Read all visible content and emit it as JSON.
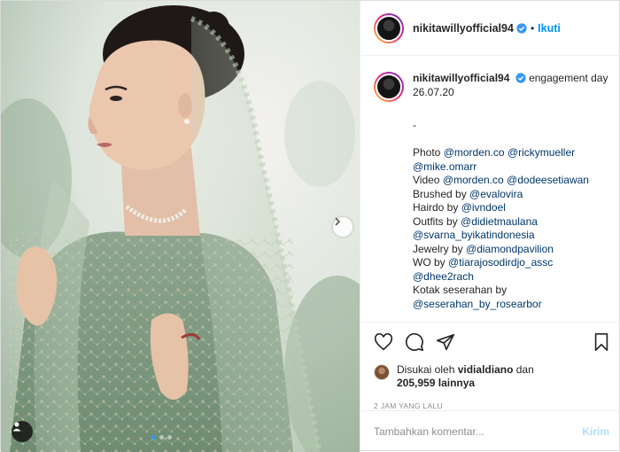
{
  "post": {
    "username": "nikitawillyofficial94",
    "follow_label": "Ikuti",
    "separator": "•",
    "caption_first": "engagement day 26.07.20",
    "caption_lines": [
      {
        "plain": "-",
        "mentions": []
      },
      {
        "plain": "",
        "mentions": []
      },
      {
        "plain": "Photo ",
        "mentions": [
          "@morden.co",
          "@rickymueller"
        ]
      },
      {
        "plain": "",
        "mentions": [
          "@mike.omarr"
        ]
      },
      {
        "plain": "Video ",
        "mentions": [
          "@morden.co",
          "@dodeesetiawan"
        ]
      },
      {
        "plain": "Brushed by ",
        "mentions": [
          "@evalovira"
        ]
      },
      {
        "plain": "Hairdo by ",
        "mentions": [
          "@ivndoel"
        ]
      },
      {
        "plain": "Outfits by ",
        "mentions": [
          "@didietmaulana"
        ]
      },
      {
        "plain": "",
        "mentions": [
          "@svarna_byikatindonesia"
        ]
      },
      {
        "plain": "Jewelry by ",
        "mentions": [
          "@diamondpavilion"
        ]
      },
      {
        "plain": "WO by ",
        "mentions": [
          "@tiarajosodirdjo_assc"
        ]
      },
      {
        "plain": "",
        "mentions": [
          "@dhee2rach"
        ]
      },
      {
        "plain": "Kotak seserahan by",
        "mentions": []
      },
      {
        "plain": "",
        "mentions": [
          "@seserahan_by_rosearbor"
        ]
      }
    ],
    "likes": {
      "prefix": "Disukai oleh",
      "user": "vidialdiano",
      "middle": "dan",
      "count": "205,959",
      "suffix": "lainnya"
    },
    "timestamp": "2 JAM YANG LALU",
    "comment_placeholder": "Tambahkan komentar...",
    "post_label": "Kirim"
  },
  "carousel": {
    "slides": 3,
    "active_index": 0
  },
  "icons": {
    "verified": "verified-badge-icon",
    "like": "heart-icon",
    "comment": "comment-bubble-icon",
    "share": "paper-plane-icon",
    "save": "bookmark-icon",
    "next": "chevron-right-icon",
    "tags": "user-tag-icon"
  },
  "colors": {
    "accent": "#0095f6",
    "mention": "#00376b",
    "muted": "#8e8e8e",
    "post_disabled": "#b2dffc",
    "dress": "#7d9a84"
  }
}
